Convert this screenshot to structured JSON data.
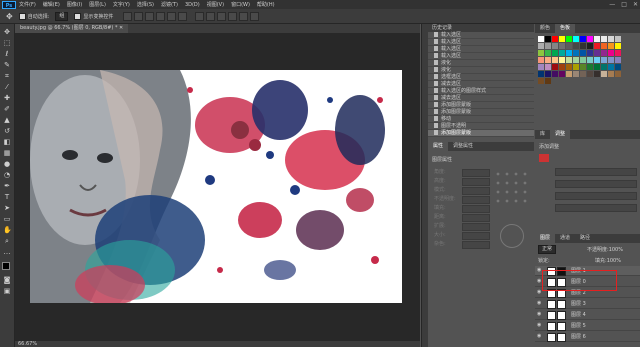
{
  "app": {
    "logo": "Ps"
  },
  "menu": [
    "文件(F)",
    "编辑(E)",
    "图像(I)",
    "图层(L)",
    "文字(Y)",
    "选择(S)",
    "滤镜(T)",
    "3D(D)",
    "视图(V)",
    "窗口(W)",
    "帮助(H)"
  ],
  "window_controls": [
    "—",
    "□",
    "✕"
  ],
  "options": {
    "auto_select_label": "自动选择:",
    "auto_select_value": "组",
    "transform_label": "显示变换控件"
  },
  "document": {
    "tab_title": "beauty.jpg @ 66.7% (图层 0, RGB/8#) *",
    "status_zoom": "66.67%"
  },
  "history": {
    "title": "历史记录",
    "items": [
      "载入选区",
      "载入选区",
      "载入选区",
      "载入选区",
      "液化",
      "液化",
      "选框选区",
      "减去选区",
      "载入选区的图层样式",
      "减去选区",
      "添加图层蒙版",
      "添加图层蒙版",
      "移动",
      "图层不透明",
      "添加图层蒙版"
    ],
    "active_index": 14
  },
  "properties": {
    "tabs": [
      "属性",
      "调整属性"
    ],
    "section_title": "图层属性",
    "labels": [
      "角度:",
      "高度:",
      "模式:",
      "不透明度:",
      "填充:",
      "距离:",
      "扩展:",
      "大小:",
      "杂色:"
    ]
  },
  "swatches": {
    "tabs": [
      "颜色",
      "色板"
    ],
    "colors": [
      "#ffffff",
      "#000000",
      "#ff0000",
      "#ffff00",
      "#00ff00",
      "#00ffff",
      "#0000ff",
      "#ff00ff",
      "#f5f5f5",
      "#ebebeb",
      "#d6d6d6",
      "#c2c2c2",
      "#adadad",
      "#999999",
      "#858585",
      "#707070",
      "#5c5c5c",
      "#474747",
      "#333333",
      "#1f1f1f",
      "#ec1c24",
      "#f26522",
      "#f7941d",
      "#fff200",
      "#8dc63f",
      "#39b54a",
      "#00a651",
      "#00a99d",
      "#00aeef",
      "#0072bc",
      "#0054a6",
      "#2e3192",
      "#662d91",
      "#92278f",
      "#ec008c",
      "#ed145b",
      "#f69679",
      "#f9ad81",
      "#fdc68a",
      "#fff799",
      "#c4df9b",
      "#a3d39c",
      "#82ca9c",
      "#7accc8",
      "#6dcff6",
      "#7da7d9",
      "#8393ca",
      "#8781bd",
      "#a186be",
      "#bd8cbf",
      "#9e0b0f",
      "#a0410d",
      "#a36209",
      "#aba000",
      "#598527",
      "#1a7b30",
      "#007236",
      "#00746b",
      "#0076a3",
      "#004b80",
      "#003471",
      "#1b1464",
      "#440e62",
      "#630460",
      "#c69c6d",
      "#998675",
      "#736357",
      "#534741",
      "#362f2d",
      "#c7b299",
      "#a67c52",
      "#8c6239",
      "#754c24",
      "#603913"
    ]
  },
  "adjustments": {
    "tabs": [
      "库",
      "调整"
    ],
    "title": "添加调整"
  },
  "layers": {
    "tabs": [
      "图层",
      "通道",
      "路径"
    ],
    "blend_mode": "正常",
    "opacity_label": "不透明度:",
    "opacity_value": "100%",
    "lock_label": "锁定:",
    "fill_label": "填充:",
    "fill_value": "100%",
    "rows": [
      "图层 1",
      "图层 0",
      "图层 2",
      "图层 3",
      "图层 4",
      "图层 5",
      "图层 6"
    ],
    "highlight_color": "#e52020"
  }
}
